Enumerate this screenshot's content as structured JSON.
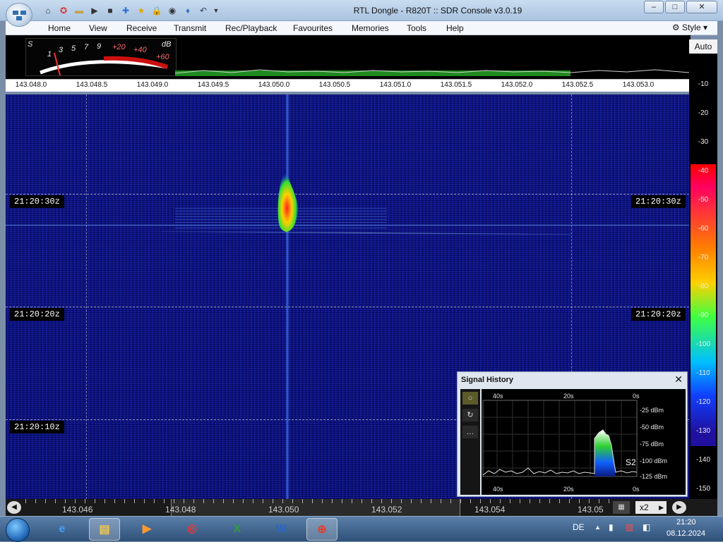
{
  "window": {
    "title": "RTL Dongle - R820T :: SDR Console v3.0.19",
    "min": "‒",
    "max": "□",
    "close": "✕"
  },
  "menu": {
    "items": [
      "Home",
      "View",
      "Receive",
      "Transmit",
      "Rec/Playback",
      "Favourites",
      "Memories",
      "Tools",
      "Help"
    ],
    "style_label": "Style"
  },
  "smeter": {
    "unit_s": "S",
    "unit_db": "dB",
    "labels": [
      "1",
      "3",
      "5",
      "7",
      "9",
      "+20",
      "+40",
      "+60"
    ]
  },
  "frequency_scale": [
    "143.048.0",
    "143.048.5",
    "143.049.0",
    "143.049.5",
    "143.050.0",
    "143.050.5",
    "143.051.0",
    "143.051.5",
    "143.052.0",
    "143.052.5",
    "143.053.0"
  ],
  "waterfall": {
    "time_labels": [
      "21:20:30z",
      "21:20:20z",
      "21:20:10z"
    ]
  },
  "db_scale": {
    "auto_label": "Auto",
    "ticks": [
      "-10",
      "-20",
      "-30",
      "-40",
      "-50",
      "-60",
      "-70",
      "-80",
      "-90",
      "-100",
      "-110",
      "-120",
      "-130",
      "-140",
      "-150"
    ]
  },
  "bottom_strip": {
    "labels": [
      "143.046",
      "143.048",
      "143.050",
      "143.052",
      "143.054",
      "143.05"
    ],
    "zoom": "x2"
  },
  "signal_history": {
    "title": "Signal History",
    "close": "✕",
    "time_labels": [
      "40s",
      "20s",
      "0s"
    ],
    "dbm_labels": [
      "-25 dBm",
      "-50 dBm",
      "-75 dBm",
      "-100 dBm",
      "-125 dBm"
    ],
    "s_reading": "S2"
  },
  "taskbar": {
    "apps": [
      "Internet Explorer",
      "Windows Explorer",
      "Media Player",
      "Chrome",
      "Excel",
      "Word",
      "SDR Console"
    ],
    "language": "DE",
    "time": "21:20",
    "date": "08.12.2024"
  },
  "colors": {
    "waterfall_bg": "#10178c",
    "signal_hot": "#ff2020",
    "signal_warm": "#ffd000",
    "signal_cool": "#30e030"
  }
}
